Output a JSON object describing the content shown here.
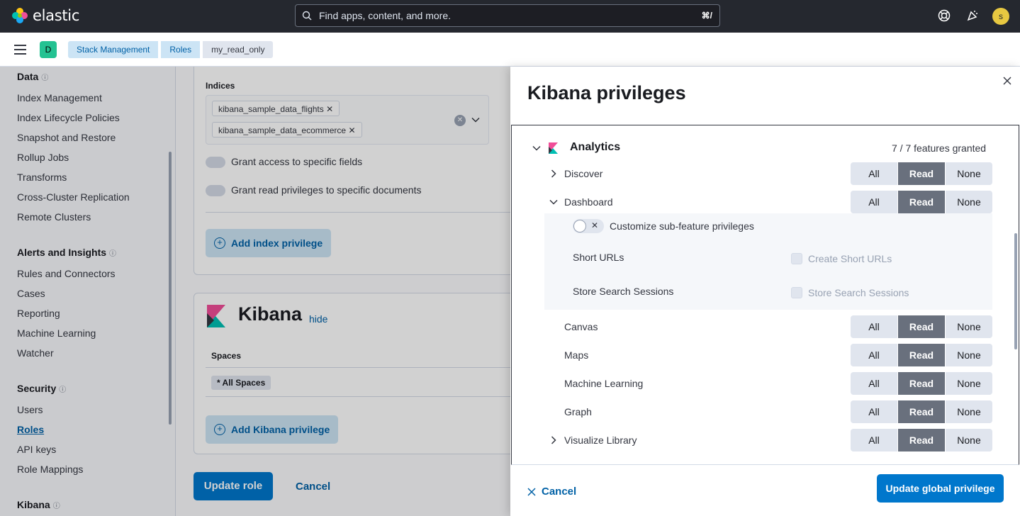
{
  "header": {
    "brand": "elastic",
    "search_placeholder": "Find apps, content, and more.",
    "search_shortcut": "⌘/",
    "avatar_initial": "s"
  },
  "breadcrumbs": {
    "space_initial": "D",
    "items": [
      "Stack Management",
      "Roles",
      "my_read_only"
    ]
  },
  "sidebar": {
    "groups": [
      {
        "label": "Data",
        "items": [
          "Index Management",
          "Index Lifecycle Policies",
          "Snapshot and Restore",
          "Rollup Jobs",
          "Transforms",
          "Cross-Cluster Replication",
          "Remote Clusters"
        ]
      },
      {
        "label": "Alerts and Insights",
        "items": [
          "Rules and Connectors",
          "Cases",
          "Reporting",
          "Machine Learning",
          "Watcher"
        ]
      },
      {
        "label": "Security",
        "items": [
          "Users",
          "Roles",
          "API keys",
          "Role Mappings"
        ]
      },
      {
        "label": "Kibana",
        "items": []
      }
    ],
    "active_item": "Roles"
  },
  "main": {
    "indices_label": "Indices",
    "indices": [
      "kibana_sample_data_flights",
      "kibana_sample_data_ecommerce"
    ],
    "field_toggle_label": "Grant access to specific fields",
    "doc_toggle_label": "Grant read privileges to specific documents",
    "add_index_label": "Add index privilege",
    "kibana_title": "Kibana",
    "hide_label": "hide",
    "spaces_header": "Spaces",
    "spaces_value": "* All Spaces",
    "add_kibana_label": "Add Kibana privilege",
    "update_role_label": "Update role",
    "cancel_label": "Cancel"
  },
  "flyout": {
    "title": "Kibana privileges",
    "category": "Analytics",
    "category_count": "7 / 7 features granted",
    "features": [
      {
        "name": "Discover",
        "selected": "Read",
        "chevron": "right"
      },
      {
        "name": "Dashboard",
        "selected": "Read",
        "chevron": "down"
      },
      {
        "name": "Canvas",
        "selected": "Read",
        "chevron": ""
      },
      {
        "name": "Maps",
        "selected": "Read",
        "chevron": ""
      },
      {
        "name": "Machine Learning",
        "selected": "Read",
        "chevron": ""
      },
      {
        "name": "Graph",
        "selected": "Read",
        "chevron": ""
      },
      {
        "name": "Visualize Library",
        "selected": "Read",
        "chevron": "right"
      }
    ],
    "priv_options": [
      "All",
      "Read",
      "None"
    ],
    "sub_toggle_label": "Customize sub-feature privileges",
    "sub_features": [
      {
        "name": "Short URLs",
        "checkbox_label": "Create Short URLs"
      },
      {
        "name": "Store Search Sessions",
        "checkbox_label": "Store Search Sessions"
      }
    ],
    "cancel_label": "Cancel",
    "update_label": "Update global privilege"
  }
}
